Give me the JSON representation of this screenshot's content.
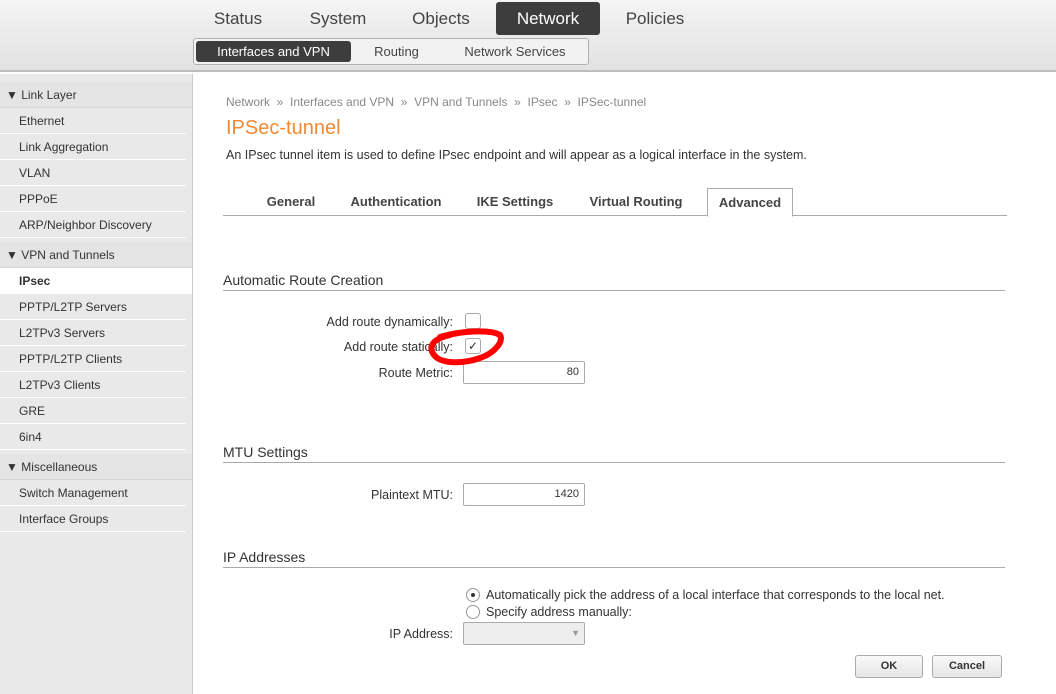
{
  "top_nav": [
    "Status",
    "System",
    "Objects",
    "Network",
    "Policies"
  ],
  "active_top": "Network",
  "sub_nav": [
    "Interfaces and VPN",
    "Routing",
    "Network Services"
  ],
  "sidebar": [
    {
      "group": "Link Layer",
      "items": [
        "Ethernet",
        "Link Aggregation",
        "VLAN",
        "PPPoE",
        "ARP/Neighbor Discovery"
      ]
    },
    {
      "group": "VPN and Tunnels",
      "items": [
        "IPsec",
        "PPTP/L2TP Servers",
        "L2TPv3 Servers",
        "PPTP/L2TP Clients",
        "L2TPv3 Clients",
        "GRE",
        "6in4"
      ]
    },
    {
      "group": "Miscellaneous",
      "items": [
        "Switch Management",
        "Interface Groups"
      ]
    }
  ],
  "active_side": "IPsec",
  "breadcrumb": "Network  »  Interfaces and VPN  »  VPN and Tunnels  »  IPsec  »  IPSec-tunnel",
  "title": "IPSec-tunnel",
  "description": "An IPsec tunnel item is used to define IPsec endpoint and will appear as a logical interface in the system.",
  "tabs": [
    "General",
    "Authentication",
    "IKE Settings",
    "Virtual Routing",
    "Advanced"
  ],
  "active_tab": "Advanced",
  "route": {
    "heading": "Automatic Route Creation",
    "dyn_label": "Add route dynamically:",
    "dyn_checked": false,
    "static_label": "Add route statically:",
    "static_checked": true,
    "check": "✓",
    "metric_label": "Route Metric:",
    "metric_value": "80"
  },
  "mtu": {
    "heading": "MTU Settings",
    "label": "Plaintext MTU:",
    "value": "1420"
  },
  "ip": {
    "heading": "IP Addresses",
    "opt_auto": "Automatically pick the address of a local interface that corresponds to the local net.",
    "opt_manual": "Specify address manually:",
    "ip_label": "IP Address:",
    "ip_value": ""
  },
  "buttons": {
    "ok": "OK",
    "cancel": "Cancel"
  },
  "colors": {
    "title": "#f08a34",
    "annotation": "#ff0000"
  }
}
